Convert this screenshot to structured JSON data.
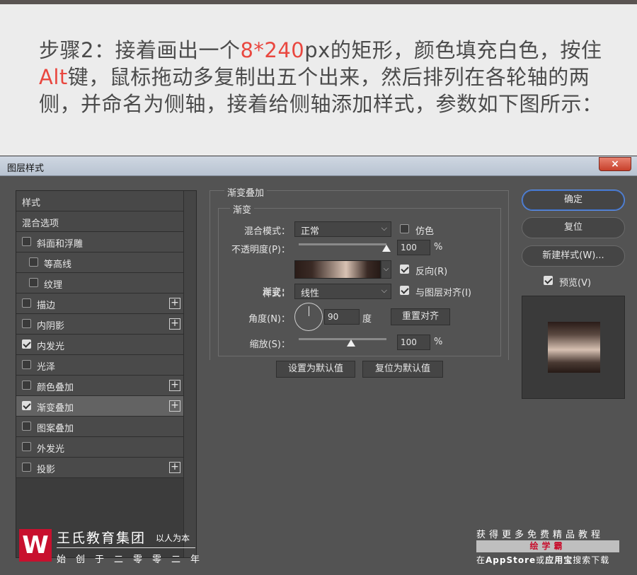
{
  "caption": {
    "part1": "步骤2：接着画出一个",
    "red1": "8*240",
    "part2": "px的矩形，颜色填充白色，按住",
    "red2": "Alt",
    "part3": "键，鼠标拖动多复制出五个出来，然后排列在各轮轴的两侧，并命名为侧轴，接着给侧轴添加样式，参数如下图所示："
  },
  "dialog": {
    "title": "图层样式",
    "close": "×"
  },
  "left_panel": {
    "items": [
      {
        "label": "样式",
        "checkbox": false,
        "checked": false,
        "plus": false,
        "indent": 0,
        "head": true
      },
      {
        "label": "混合选项",
        "checkbox": false,
        "checked": false,
        "plus": false,
        "indent": 0,
        "head": true
      },
      {
        "label": "斜面和浮雕",
        "checkbox": true,
        "checked": false,
        "plus": false,
        "indent": 0
      },
      {
        "label": "等高线",
        "checkbox": true,
        "checked": false,
        "plus": false,
        "indent": 1
      },
      {
        "label": "纹理",
        "checkbox": true,
        "checked": false,
        "plus": false,
        "indent": 1
      },
      {
        "label": "描边",
        "checkbox": true,
        "checked": false,
        "plus": true,
        "indent": 0
      },
      {
        "label": "内阴影",
        "checkbox": true,
        "checked": false,
        "plus": true,
        "indent": 0
      },
      {
        "label": "内发光",
        "checkbox": true,
        "checked": true,
        "plus": false,
        "indent": 0
      },
      {
        "label": "光泽",
        "checkbox": true,
        "checked": false,
        "plus": false,
        "indent": 0
      },
      {
        "label": "颜色叠加",
        "checkbox": true,
        "checked": false,
        "plus": true,
        "indent": 0
      },
      {
        "label": "渐变叠加",
        "checkbox": true,
        "checked": true,
        "plus": true,
        "indent": 0,
        "selected": true
      },
      {
        "label": "图案叠加",
        "checkbox": true,
        "checked": false,
        "plus": false,
        "indent": 0
      },
      {
        "label": "外发光",
        "checkbox": true,
        "checked": false,
        "plus": false,
        "indent": 0
      },
      {
        "label": "投影",
        "checkbox": true,
        "checked": false,
        "plus": true,
        "indent": 0
      }
    ],
    "plus_glyph": "+"
  },
  "gradient_overlay": {
    "group_title": "渐变叠加",
    "inner_title": "渐变",
    "blend_mode_label": "混合模式：",
    "blend_mode_value": "正常",
    "dither_label": "仿色",
    "dither_checked": false,
    "opacity_label": "不透明度(P)：",
    "opacity_value": "100",
    "opacity_unit": "%",
    "opacity_level": 1.0,
    "gradient_label": "渐变：",
    "reverse_label": "反向(R)",
    "reverse_checked": true,
    "style_label": "样式：",
    "style_value": "线性",
    "align_label": "与图层对齐(I)",
    "align_checked": true,
    "angle_label": "角度(N)：",
    "angle_value": "90",
    "angle_unit": "度",
    "reset_align_label": "重置对齐",
    "scale_label": "缩放(S)：",
    "scale_value": "100",
    "scale_unit": "%",
    "scale_level": 0.6,
    "set_default_label": "设置为默认值",
    "reset_default_label": "复位为默认值",
    "dropdown_glyph": "⌵",
    "gradient_colors": [
      "#2a1c18",
      "#d8c2b3",
      "#261a16"
    ]
  },
  "right_panel": {
    "ok_label": "确定",
    "reset_label": "复位",
    "new_style_label": "新建样式(W)...",
    "preview_label": "预览(V)",
    "preview_checked": true
  },
  "watermark": {
    "logo_glyph": "W",
    "name": "王氏教育集团",
    "slogan": "以人为本",
    "sub": "始创于二零零二年",
    "right_line1": "获得更多免费精品教程",
    "right_badge": "绘学霸",
    "right_line2_a": "在",
    "right_line2_b": "AppStore",
    "right_line2_c": "或",
    "right_line2_d": "应用宝",
    "right_line2_e": "搜索下载"
  }
}
